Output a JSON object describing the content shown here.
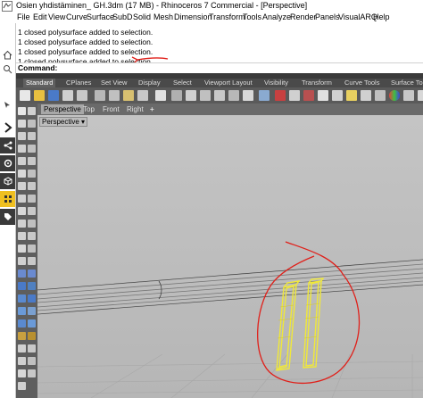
{
  "window": {
    "title": "Osien yhdistäminen_ GH.3dm (17 MB) - Rhinoceros 7 Commercial - [Perspective]"
  },
  "menu": [
    "File",
    "Edit",
    "View",
    "Curve",
    "Surface",
    "SubD",
    "Solid",
    "Mesh",
    "Dimension",
    "Transform",
    "Tools",
    "Analyze",
    "Render",
    "Panels",
    "VisualARQ",
    "Help"
  ],
  "history": {
    "lines": [
      "1 closed polysurface added to selection.",
      "1 closed polysurface added to selection.",
      "1 closed polysurface added to selection.",
      "1 closed polysurface added to selection."
    ]
  },
  "command": {
    "label": "Command:",
    "value": ""
  },
  "toolbar_tabs": [
    "Standard",
    "CPlanes",
    "Set View",
    "Display",
    "Select",
    "Viewport Layout",
    "Visibility",
    "Transform",
    "Curve Tools",
    "Surface Tools"
  ],
  "viewport_tabs": [
    "Perspective",
    "Top",
    "Front",
    "Right",
    "+"
  ],
  "viewport": {
    "label": "Perspective"
  },
  "colors": {
    "annotation": "#e0201a",
    "selection": "#f0e83a",
    "toolbar": "#5a5a5a"
  }
}
